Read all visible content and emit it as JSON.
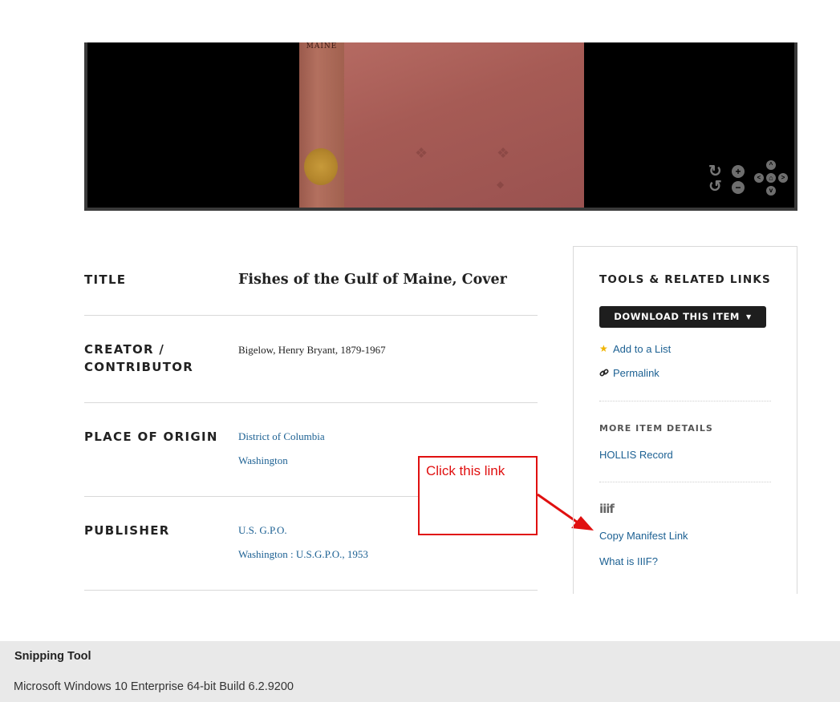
{
  "viewer": {
    "spine_text": "MAINE",
    "controls": {
      "rotate_right": "↻",
      "rotate_left": "↺",
      "zoom_in": "+",
      "zoom_out": "−",
      "pan_up": "^",
      "pan_down": "v",
      "pan_left": "<",
      "pan_right": ">",
      "home": "⌂"
    }
  },
  "metadata": {
    "title": {
      "label": "TITLE",
      "value": "Fishes of the Gulf of Maine, Cover"
    },
    "creator": {
      "label_line1": "CREATOR /",
      "label_line2": "CONTRIBUTOR",
      "value": "Bigelow, Henry Bryant, 1879-1967"
    },
    "place": {
      "label": "PLACE OF ORIGIN",
      "links": [
        "District of Columbia",
        "Washington"
      ]
    },
    "publisher": {
      "label": "PUBLISHER",
      "links": [
        "U.S. G.P.O.",
        "Washington : U.S.G.P.O., 1953"
      ]
    }
  },
  "sidebar": {
    "heading": "TOOLS & RELATED LINKS",
    "download_label": "DOWNLOAD THIS ITEM",
    "add_to_list": "Add to a List",
    "permalink": "Permalink",
    "more_details_heading": "MORE ITEM DETAILS",
    "hollis_record": "HOLLIS Record",
    "iiif_logo": "iiif",
    "copy_manifest": "Copy Manifest Link",
    "what_is_iiif": "What is IIIF?"
  },
  "annotation": {
    "text": "Click this link",
    "color": "#e01010"
  },
  "footer": {
    "title": "Snipping Tool",
    "subtitle": "Microsoft Windows 10 Enterprise 64-bit Build 6.2.9200"
  },
  "colors": {
    "link": "#1d6193",
    "button_bg": "#1e1e1e",
    "star": "#f0b400",
    "footer_bg": "#e9e9e9"
  }
}
